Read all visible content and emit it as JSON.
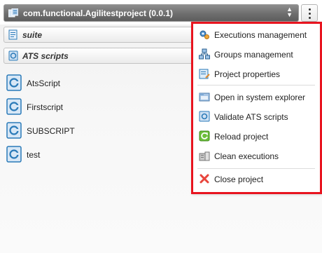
{
  "project": {
    "title": "com.functional.Agilitestproject (0.0.1)"
  },
  "suite_bar": {
    "label": "suite"
  },
  "ats_bar": {
    "label": "ATS scripts"
  },
  "scripts": [
    "AtsScript",
    "Firstscript",
    "SUBSCRIPT",
    "test"
  ],
  "menu": {
    "executions": "Executions management",
    "groups": "Groups management",
    "properties": "Project properties",
    "explorer": "Open in system explorer",
    "validate": "Validate ATS scripts",
    "reload": "Reload project",
    "clean": "Clean executions",
    "close": "Close project"
  },
  "colors": {
    "highlight_border": "#e8141f",
    "header_bg": "#6e6e6e",
    "accent_blue": "#2a7ab8"
  }
}
